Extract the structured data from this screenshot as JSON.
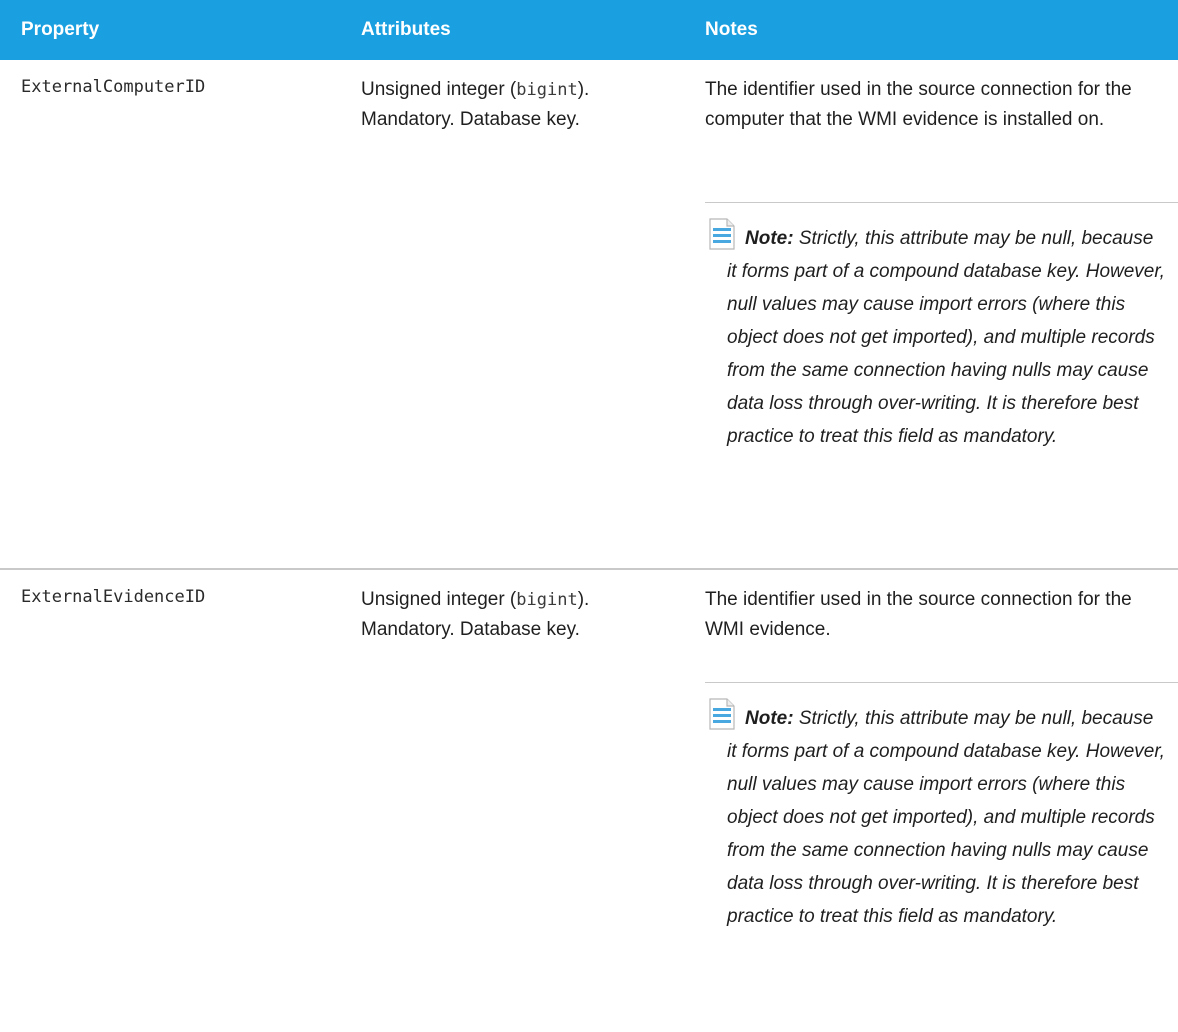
{
  "header": {
    "property": "Property",
    "attributes": "Attributes",
    "notes": "Notes"
  },
  "rows": [
    {
      "property": "ExternalComputerID",
      "attr_prefix": "Unsigned integer (",
      "attr_code": "bigint",
      "attr_suffix": ").",
      "attr_line2": "Mandatory. Database key.",
      "notes": "The identifier used in the source connection for the computer that the WMI evidence is installed on.",
      "note_label": "Note:",
      "note_body": " Strictly, this attribute may be null, because it forms part of a compound database key. However, null values may cause import errors (where this object does not get imported), and multiple records from the same connection having nulls may cause data loss through over-writing. It is therefore best practice to treat this field as mandatory."
    },
    {
      "property": "ExternalEvidenceID",
      "attr_prefix": "Unsigned integer (",
      "attr_code": "bigint",
      "attr_suffix": ").",
      "attr_line2": "Mandatory. Database key.",
      "notes": "The identifier used in the source connection for the WMI evidence.",
      "note_label": "Note:",
      "note_body": " Strictly, this attribute may be null, because it forms part of a compound database key. However, null values may cause import errors (where this object does not get imported), and multiple records from the same connection having nulls may cause data loss through over-writing. It is therefore best practice to treat this field as mandatory."
    }
  ],
  "colors": {
    "header_bg": "#1a9fe0",
    "header_text": "#ffffff",
    "divider": "#c9c9c9",
    "note_icon": "#4aa8e0"
  },
  "icons": {
    "note": "note-document-icon"
  }
}
